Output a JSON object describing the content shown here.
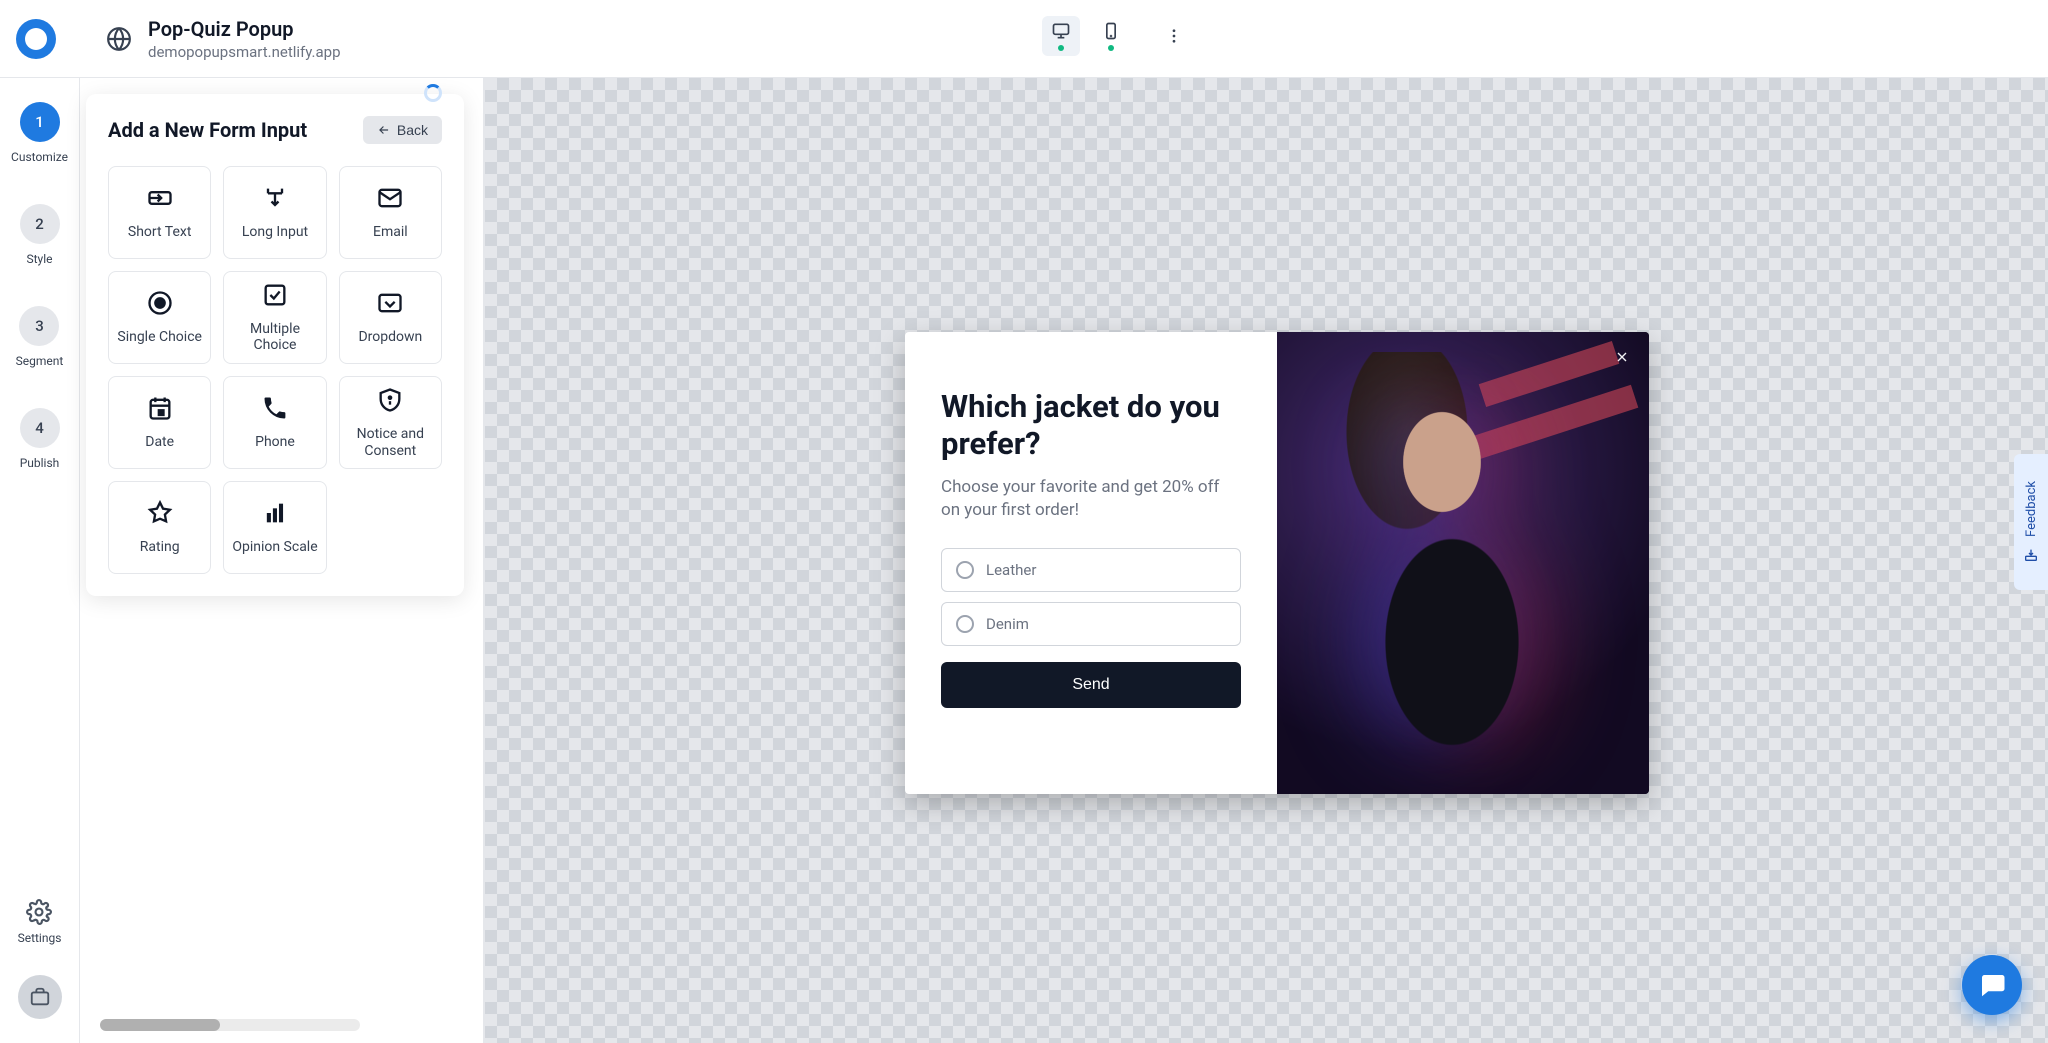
{
  "header": {
    "title": "Pop-Quiz Popup",
    "subtitle": "demopopupsmart.netlify.app"
  },
  "rail": {
    "steps": [
      {
        "num": "1",
        "label": "Customize"
      },
      {
        "num": "2",
        "label": "Style"
      },
      {
        "num": "3",
        "label": "Segment"
      },
      {
        "num": "4",
        "label": "Publish"
      }
    ],
    "settings_label": "Settings"
  },
  "form_panel": {
    "title": "Add a New Form Input",
    "back_label": "Back",
    "types": [
      "Short Text",
      "Long Input",
      "Email",
      "Single Choice",
      "Multiple Choice",
      "Dropdown",
      "Date",
      "Phone",
      "Notice and Consent",
      "Rating",
      "Opinion Scale"
    ]
  },
  "popup": {
    "heading": "Which jacket do you prefer?",
    "subheading": "Choose your favorite and get 20% off on your first order!",
    "choices": [
      "Leather",
      "Denim"
    ],
    "submit_label": "Send"
  },
  "feedback_label": "Feedback"
}
